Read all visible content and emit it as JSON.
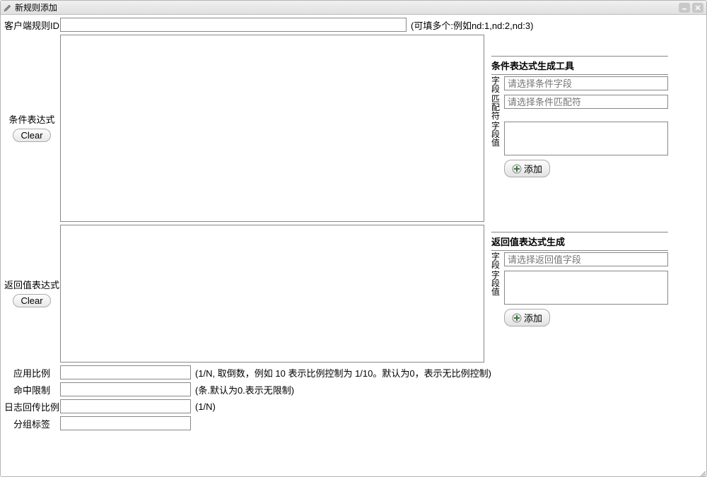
{
  "window": {
    "title": "新规则添加"
  },
  "rows": {
    "client_rule_id": {
      "label": "客户端规则ID",
      "value": "",
      "hint": "(可填多个:例如nd:1,nd:2,nd:3)"
    },
    "condition_expr": {
      "label": "条件表达式",
      "clear": "Clear",
      "value": ""
    },
    "return_expr": {
      "label": "返回值表达式",
      "clear": "Clear",
      "value": ""
    },
    "app_ratio": {
      "label": "应用比例",
      "value": "",
      "hint": "(1/N, 取倒数，例如 10 表示比例控制为 1/10。默认为0，表示无比例控制)"
    },
    "hit_limit": {
      "label": "命中限制",
      "value": "",
      "hint": "(条.默认为0.表示无限制)"
    },
    "log_ratio": {
      "label": "日志回传比例",
      "value": "",
      "hint": "(1/N)"
    },
    "group_tag": {
      "label": "分组标签",
      "value": ""
    }
  },
  "cond_tool": {
    "title": "条件表达式生成工具",
    "field_label": "字段",
    "field_placeholder": "请选择条件字段",
    "matcher_label": "匹配符",
    "matcher_placeholder": "请选择条件匹配符",
    "value_label": "字段值",
    "value_value": "",
    "add": "添加"
  },
  "ret_tool": {
    "title": "返回值表达式生成",
    "field_label": "字段",
    "field_placeholder": "请选择返回值字段",
    "value_label": "字段值",
    "value_value": "",
    "add": "添加"
  }
}
